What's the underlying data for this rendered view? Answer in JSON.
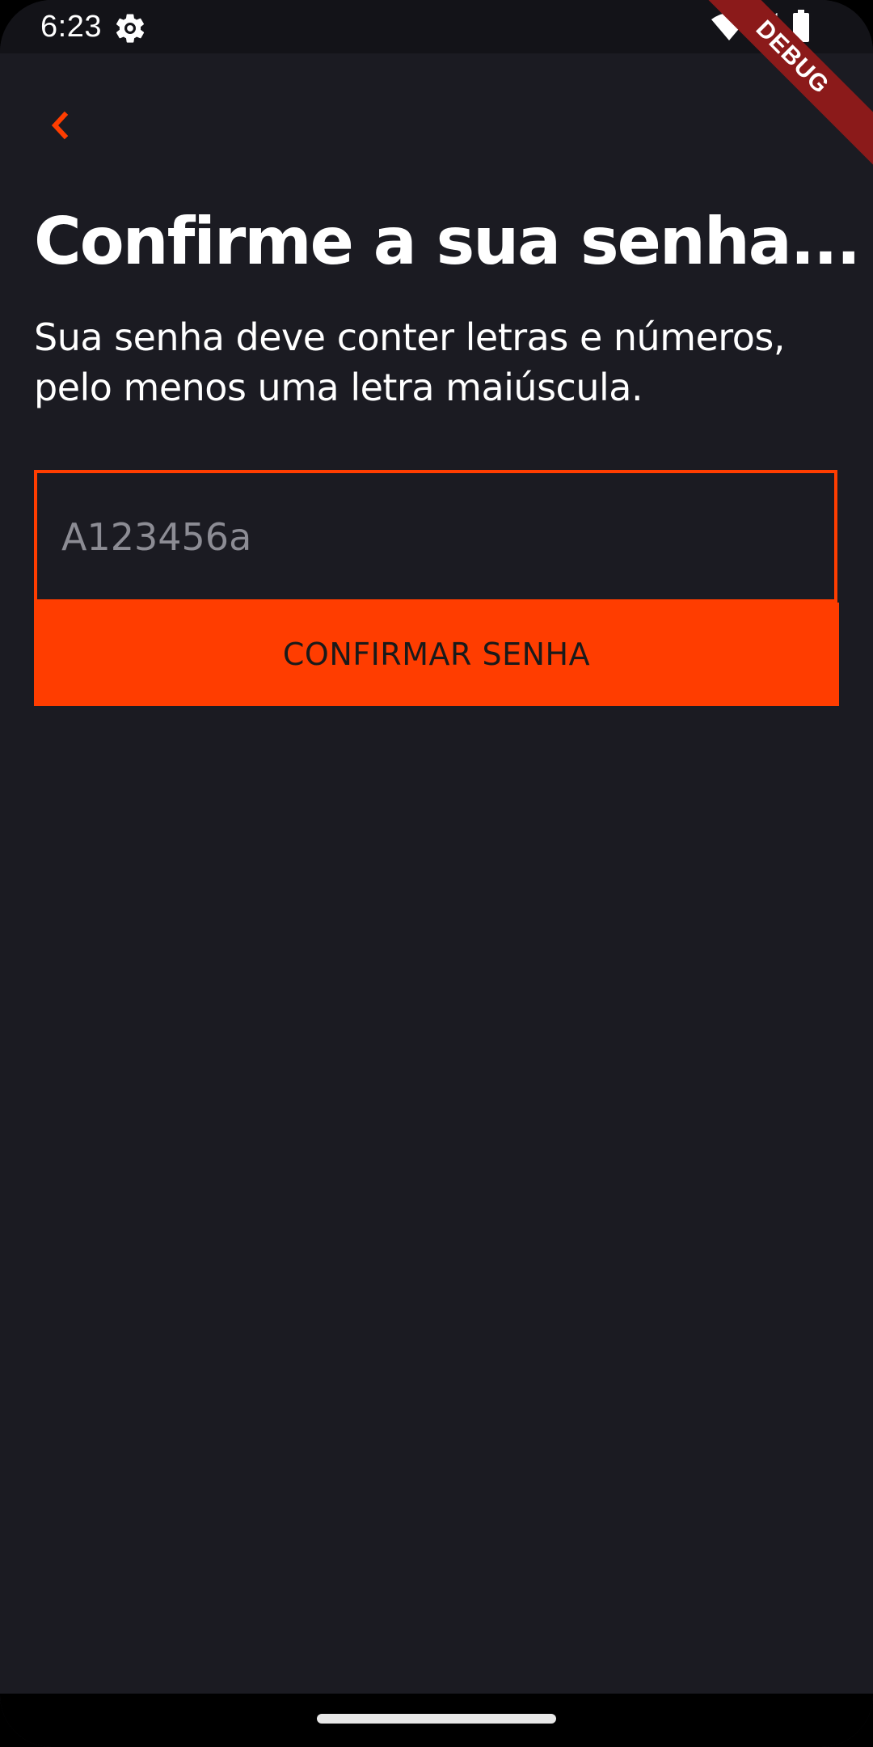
{
  "status_bar": {
    "time": "6:23",
    "icons": [
      "gear-icon",
      "wifi-icon",
      "signal-icon",
      "battery-icon"
    ]
  },
  "debug_banner": "DEBUG",
  "back_button": {
    "icon": "chevron-left-icon",
    "color": "#ff3d00"
  },
  "title": "Confirme a sua senha...",
  "subtitle": "Sua senha deve conter letras e números, pelo menos uma letra maiúscula.",
  "password_field": {
    "placeholder": "A123456a",
    "value": ""
  },
  "confirm_button": {
    "label": "CONFIRMAR SENHA"
  },
  "colors": {
    "accent": "#ff3d00",
    "background": "#1b1b22",
    "text": "#ffffff",
    "placeholder": "#8c8c94"
  }
}
